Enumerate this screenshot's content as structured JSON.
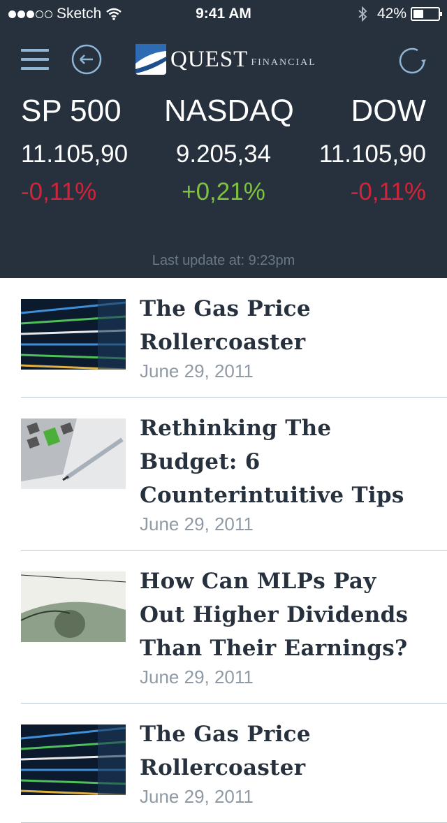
{
  "status_bar": {
    "carrier": "Sketch",
    "time": "9:41 AM",
    "battery": "42%",
    "signal_bars": 3,
    "battery_level": 0.42
  },
  "brand": {
    "name": "QUEST",
    "sub": "FINANCIAL",
    "bg": "#27313d",
    "accent": "#8fb6d6",
    "negative": "#d0243a",
    "positive": "#7dc242"
  },
  "indices": [
    {
      "name": "SP 500",
      "value": "11.105,90",
      "change": "-0,11%",
      "trend": "neg"
    },
    {
      "name": "NASDAQ",
      "value": "9.205,34",
      "change": "+0,21%",
      "trend": "pos"
    },
    {
      "name": "DOW",
      "value": "11.105,90",
      "change": "-0,11%",
      "trend": "neg"
    }
  ],
  "last_update": "Last update at: 9:23pm",
  "articles": [
    {
      "title": "The Gas Price Rollercoaster",
      "date": "June 29, 2011",
      "thumb": "stock-ticker"
    },
    {
      "title": "Rethinking The Budget: 6 Counterintuitive Tips",
      "date": "June 29, 2011",
      "thumb": "calculator"
    },
    {
      "title": "How Can MLPs Pay Out Higher Dividends Than Their Earnings?",
      "date": "June 29, 2011",
      "thumb": "earnings"
    },
    {
      "title": "The Gas Price Rollercoaster",
      "date": "June 29, 2011",
      "thumb": "stock-ticker"
    }
  ]
}
